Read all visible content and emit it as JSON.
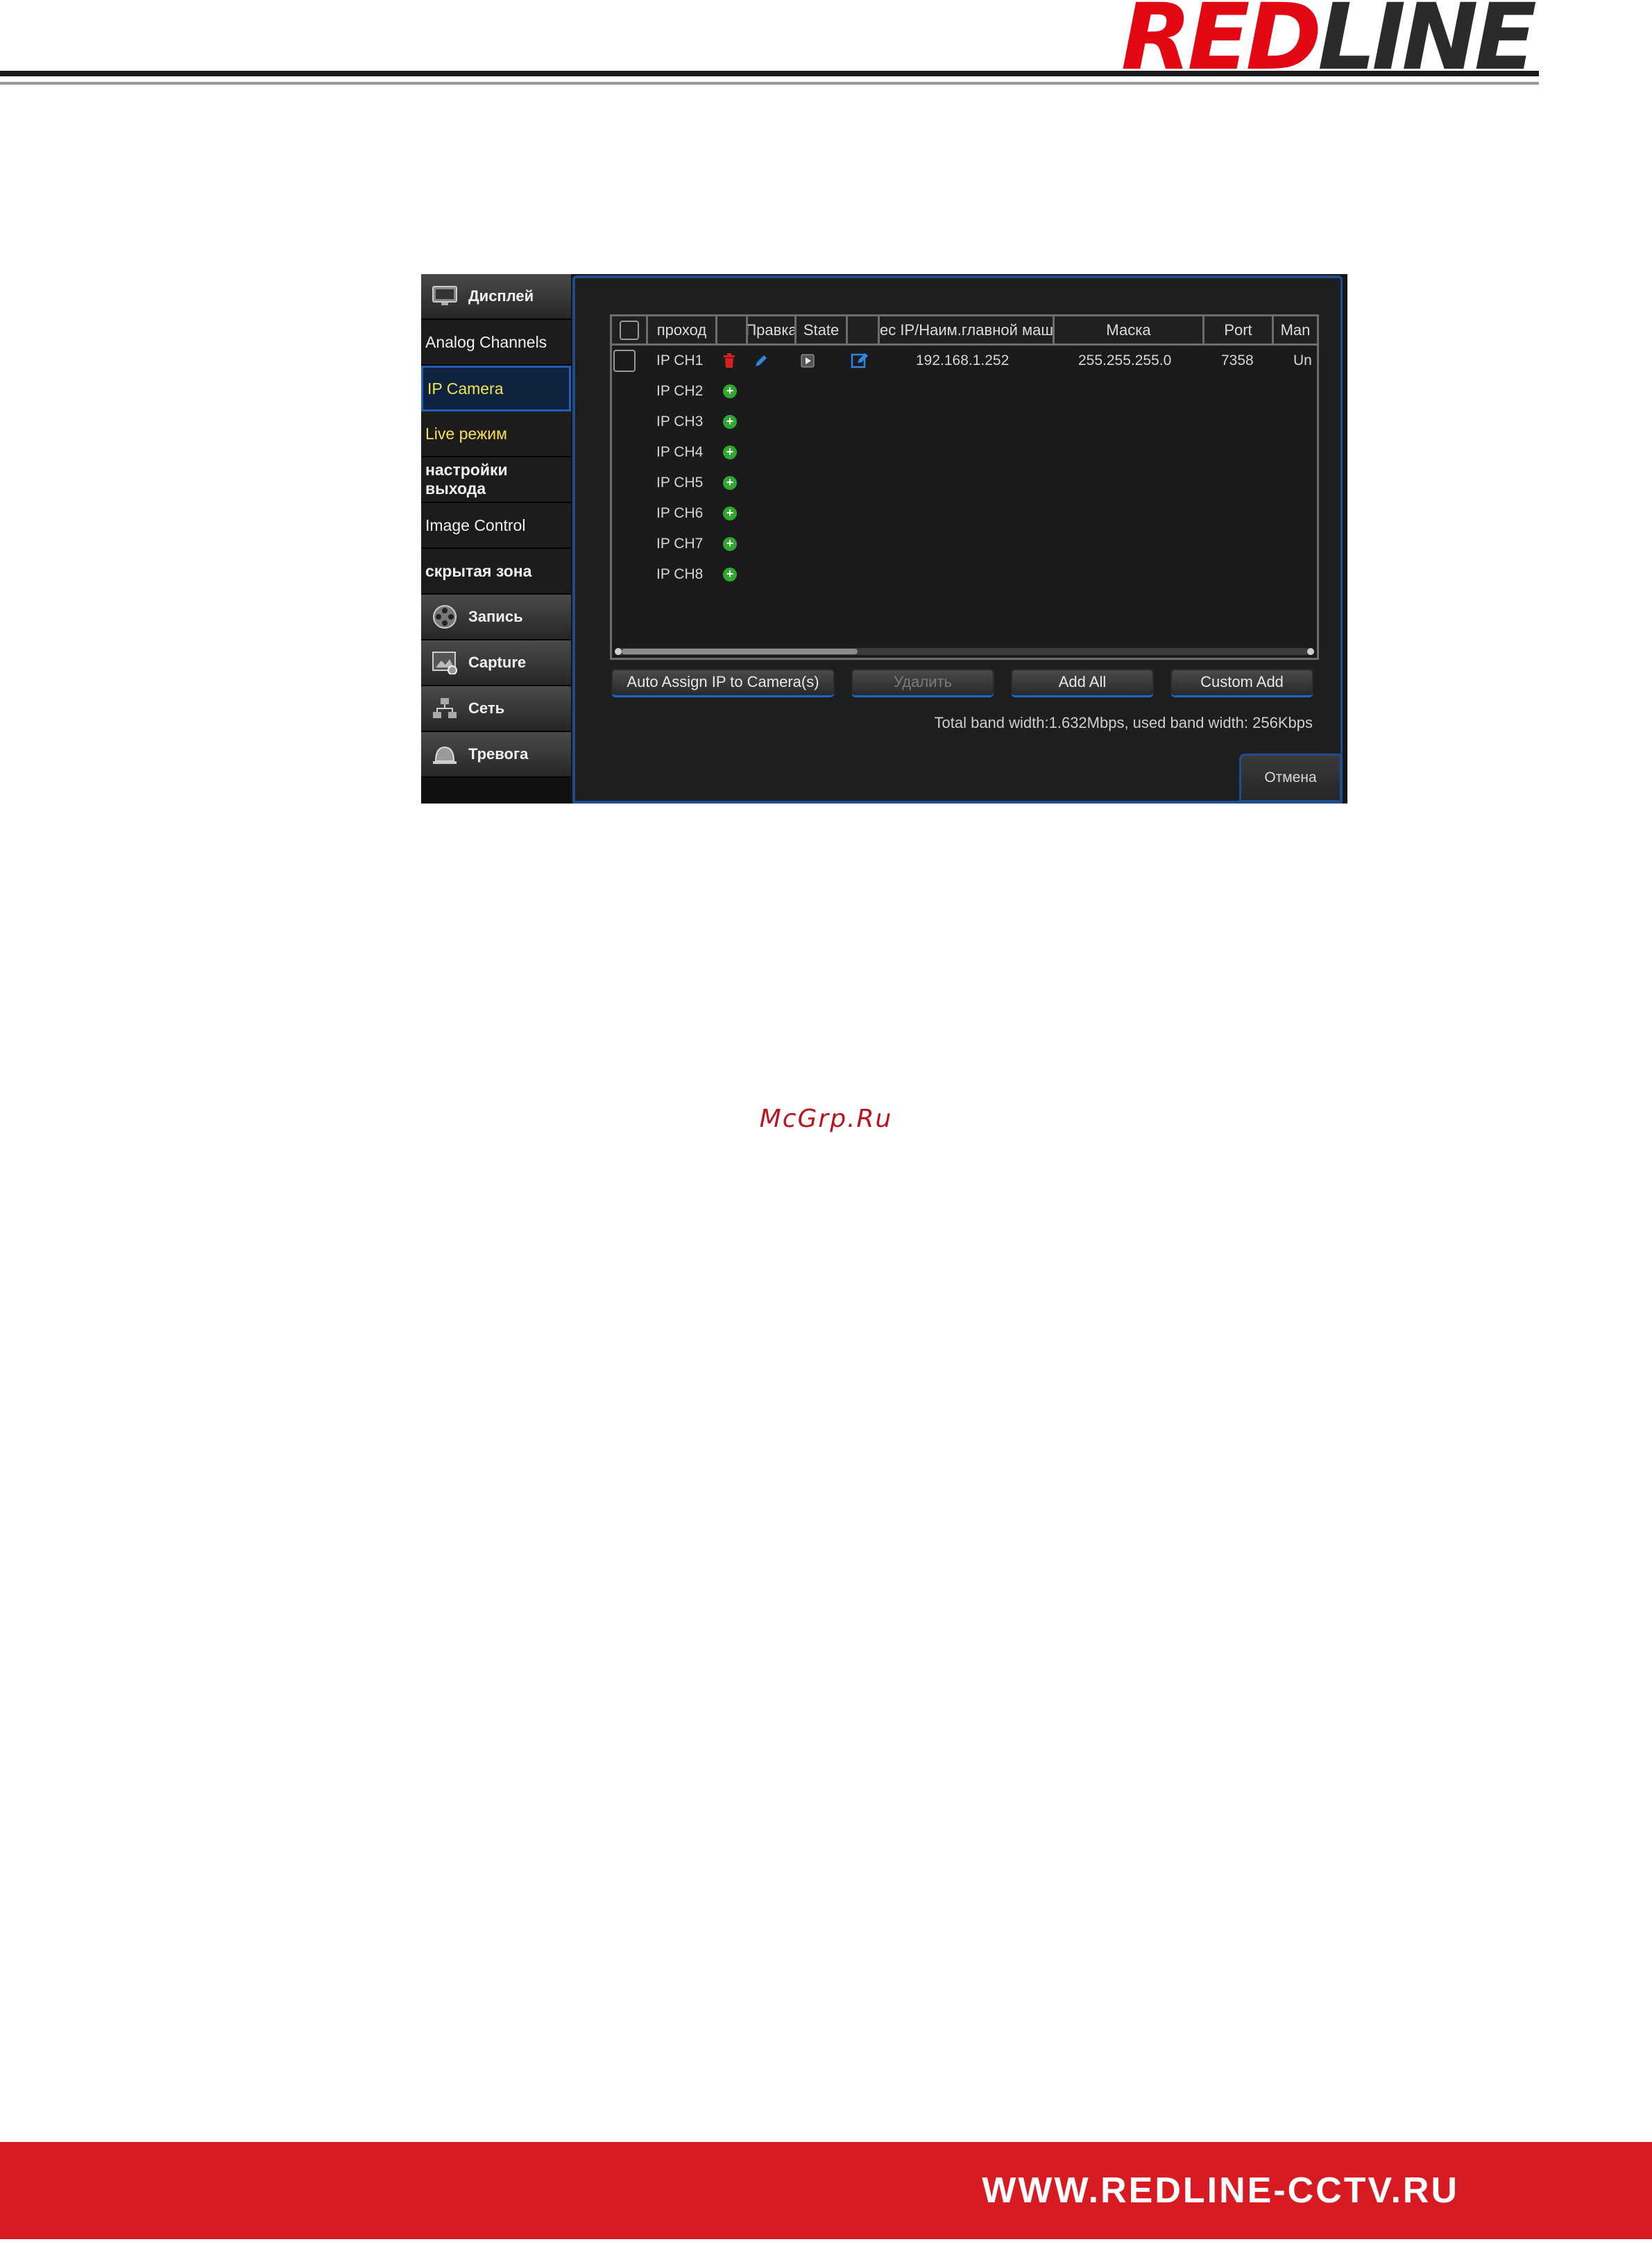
{
  "brand": {
    "logo_red": "RED",
    "logo_dark": "LINE",
    "red_color": "#e30613"
  },
  "sidebar": {
    "items": [
      {
        "label": "Дисплей",
        "kind": "category",
        "icon": "monitor-icon"
      },
      {
        "label": "Analog Channels",
        "kind": "sub"
      },
      {
        "label": "IP Camera",
        "kind": "sub",
        "state": "active"
      },
      {
        "label": "Live режим",
        "kind": "sub"
      },
      {
        "label": "настройки выхода",
        "kind": "sub"
      },
      {
        "label": "Image Control",
        "kind": "sub"
      },
      {
        "label": "скрытая зона",
        "kind": "sub"
      },
      {
        "label": "Запись",
        "kind": "category",
        "icon": "film-reel-icon"
      },
      {
        "label": "Capture",
        "kind": "category",
        "icon": "picture-icon"
      },
      {
        "label": "Сеть",
        "kind": "category",
        "icon": "network-icon"
      },
      {
        "label": "Тревога",
        "kind": "category",
        "icon": "alarm-bell-icon"
      }
    ]
  },
  "table": {
    "headers": [
      "проход",
      "Правка",
      "State",
      "ес IP/Наим.главной маш",
      "Маска",
      "Port",
      "Man"
    ],
    "rows": [
      {
        "channel": "IP CH1",
        "ip": "192.168.1.252",
        "mask": "255.255.255.0",
        "port": "7358",
        "man": "Un",
        "configured": true
      },
      {
        "channel": "IP CH2",
        "configured": false
      },
      {
        "channel": "IP CH3",
        "configured": false
      },
      {
        "channel": "IP CH4",
        "configured": false
      },
      {
        "channel": "IP CH5",
        "configured": false
      },
      {
        "channel": "IP CH6",
        "configured": false
      },
      {
        "channel": "IP CH7",
        "configured": false
      },
      {
        "channel": "IP CH8",
        "configured": false
      }
    ]
  },
  "buttons": {
    "auto_assign": "Auto Assign IP to Camera(s)",
    "delete": "Удалить",
    "add_all": "Add All",
    "custom_add": "Custom Add",
    "cancel": "Отмена"
  },
  "bandwidth_text": "Total band width:1.632Mbps, used band width: 256Kbps",
  "watermark": "McGrp.Ru",
  "footer": {
    "url": "WWW.REDLINE-CCTV.RU",
    "color": "#d81b22"
  }
}
